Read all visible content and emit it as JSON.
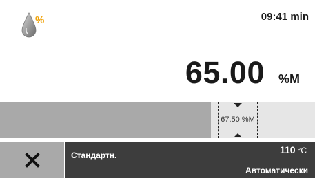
{
  "header": {
    "mode_icon": "moisture-percent-drop-icon",
    "time": "09:41 min"
  },
  "reading": {
    "value": "65.00",
    "unit": "%M"
  },
  "progress": {
    "target_label": "67.50 %M",
    "fill_percent": 67
  },
  "footer": {
    "cancel_icon": "close-x-icon",
    "method": "Стандартн.",
    "temperature_value": "110",
    "temperature_unit": "°C",
    "mode": "Автоматически"
  },
  "colors": {
    "drop_gray": "#8a8a8a",
    "percent_orange": "#f0a30a",
    "panel_dark": "#3d3d3d",
    "button_gray": "#a9a9a9",
    "progress_fill": "#a9a9a9",
    "progress_track": "#e6e6e6"
  }
}
